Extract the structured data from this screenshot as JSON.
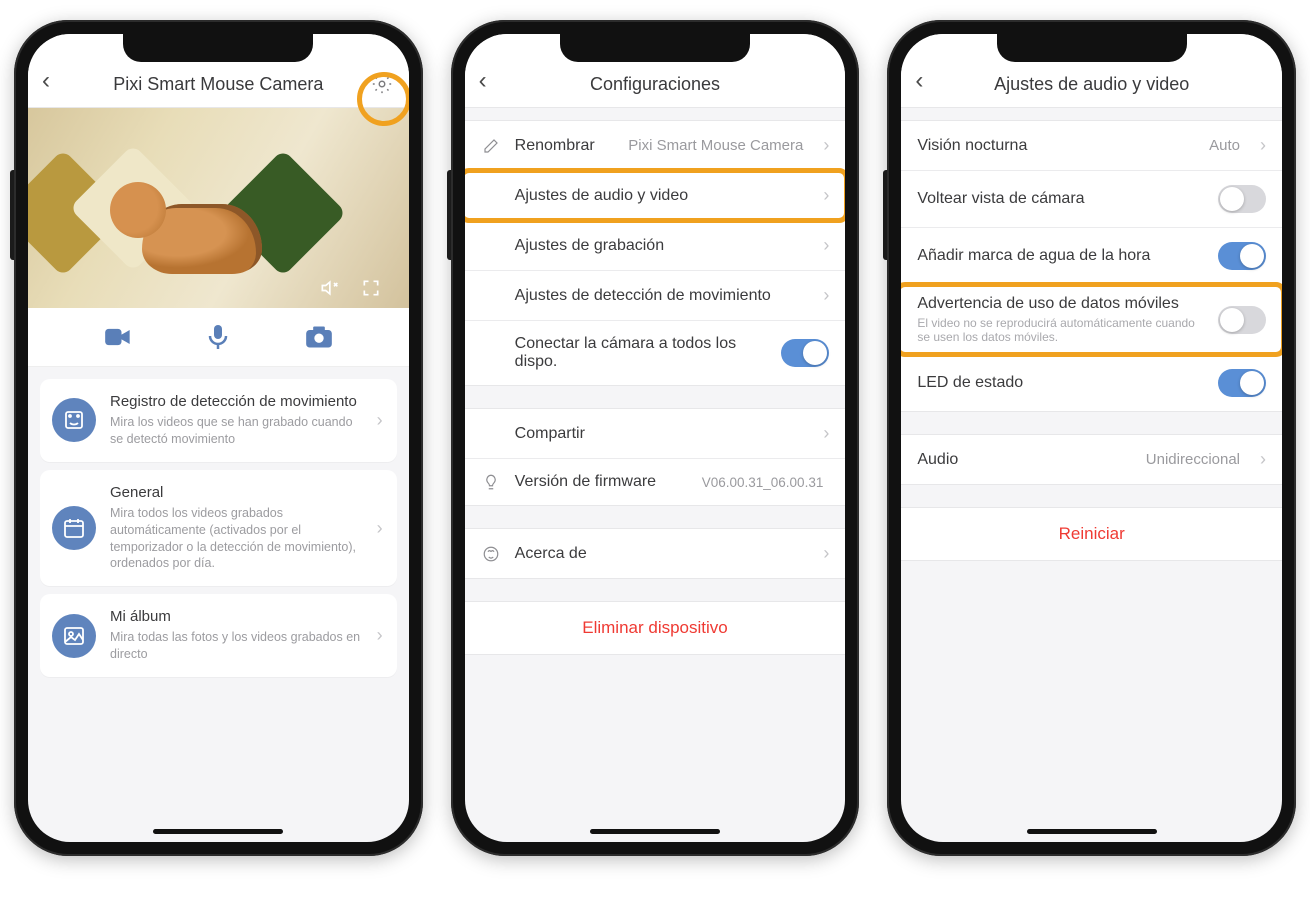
{
  "phone1": {
    "title": "Pixi Smart Mouse Camera",
    "cards": [
      {
        "title": "Registro de detección de movimiento",
        "subtitle": "Mira los videos que se han grabado cuando se detectó movimiento"
      },
      {
        "title": "General",
        "subtitle": "Mira todos los videos grabados automáticamente (activados por el temporizador o la detección de movimiento), ordenados por día."
      },
      {
        "title": "Mi álbum",
        "subtitle": "Mira todas las fotos y los videos grabados en directo"
      }
    ]
  },
  "phone2": {
    "title": "Configuraciones",
    "rename_label": "Renombrar",
    "rename_value": "Pixi Smart Mouse Camera",
    "rows": {
      "av": "Ajustes de audio y video",
      "rec": "Ajustes de grabación",
      "motion": "Ajustes de detección de movimiento",
      "connect_all": "Conectar la cámara a todos los dispo.",
      "share": "Compartir",
      "fw_label": "Versión de firmware",
      "fw_value": "V06.00.31_06.00.31",
      "about": "Acerca de"
    },
    "danger": "Eliminar dispositivo"
  },
  "phone3": {
    "title": "Ajustes de audio y video",
    "night_vision_label": "Visión nocturna",
    "night_vision_value": "Auto",
    "flip_label": "Voltear vista de cámara",
    "watermark_label": "Añadir marca de agua de la hora",
    "mobile_warn_label": "Advertencia de uso de datos móviles",
    "mobile_warn_sub": "El video no se reproducirá automáticamente cuando se usen los datos móviles.",
    "led_label": "LED de estado",
    "audio_label": "Audio",
    "audio_value": "Unidireccional",
    "danger": "Reiniciar"
  }
}
